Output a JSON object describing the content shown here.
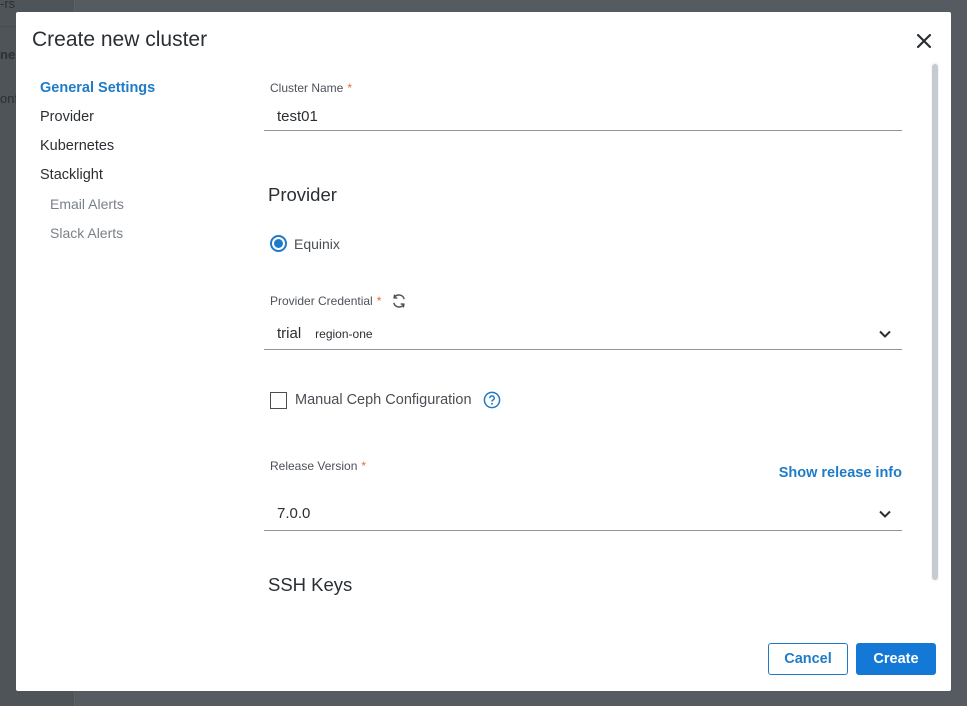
{
  "background": {
    "sidebar_fragments": [
      "-rs",
      "ne.",
      "onf"
    ]
  },
  "modal": {
    "title": "Create new cluster",
    "close_icon": "close-icon"
  },
  "nav": {
    "items": [
      {
        "label": "General Settings",
        "active": true
      },
      {
        "label": "Provider"
      },
      {
        "label": "Kubernetes"
      },
      {
        "label": "Stacklight"
      },
      {
        "label": "Email Alerts",
        "sub": true
      },
      {
        "label": "Slack Alerts",
        "sub": true
      }
    ]
  },
  "form": {
    "cluster_name": {
      "label": "Cluster Name",
      "required": "*",
      "value": "test01"
    },
    "provider_heading": "Provider",
    "provider_option": {
      "label": "Equinix",
      "selected": true
    },
    "provider_credential": {
      "label": "Provider Credential",
      "required": "*",
      "value": "trial",
      "region": "region-one",
      "refresh_icon": "refresh-icon"
    },
    "manual_ceph": {
      "label": "Manual Ceph Configuration",
      "checked": false,
      "help_icon": "help-icon"
    },
    "release_version": {
      "label": "Release Version",
      "required": "*",
      "value": "7.0.0",
      "info_link": "Show release info"
    },
    "ssh_heading": "SSH Keys"
  },
  "footer": {
    "cancel_label": "Cancel",
    "create_label": "Create"
  },
  "colors": {
    "accent": "#1f7bc7",
    "primary_button": "#1479d6",
    "required": "#e86a3a"
  }
}
